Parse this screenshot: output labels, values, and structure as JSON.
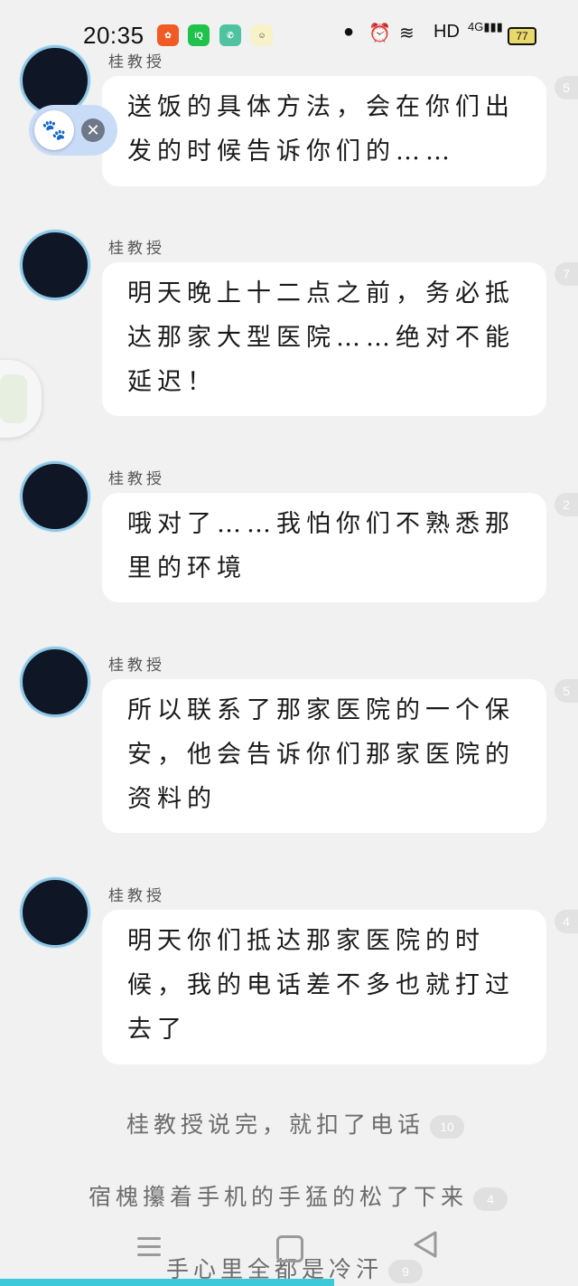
{
  "status_bar": {
    "time": "20:35",
    "network": "HD",
    "signal": "4G",
    "battery": "77"
  },
  "messages": [
    {
      "sender": "桂教授",
      "text": "送饭的具体方法，会在你们出发的时候告诉你们的……",
      "count": "5"
    },
    {
      "sender": "桂教授",
      "text": "明天晚上十二点之前，务必抵达那家大型医院……绝对不能延迟！",
      "count": "7"
    },
    {
      "sender": "桂教授",
      "text": "哦对了……我怕你们不熟悉那里的环境",
      "count": "2"
    },
    {
      "sender": "桂教授",
      "text": "所以联系了那家医院的一个保安，他会告诉你们那家医院的资料的",
      "count": "5"
    },
    {
      "sender": "桂教授",
      "text": "明天你们抵达那家医院的时候，我的电话差不多也就打过去了",
      "count": "4"
    }
  ],
  "narration": [
    {
      "text": "桂教授说完，就扣了电话",
      "count": "10"
    },
    {
      "text": "宿槐攥着手机的手猛的松了下来",
      "count": "4"
    },
    {
      "text": "手心里全都是冷汗",
      "count": "9"
    }
  ],
  "icons": {
    "floating": "paw-icon",
    "close": "close-icon",
    "nav": [
      "menu-icon",
      "home-icon",
      "back-icon"
    ]
  },
  "colors": {
    "background": "#f1f1f1",
    "bubble": "#ffffff",
    "avatar_ring": "#8fc8e6",
    "accent_strip": "#3cc9d9"
  }
}
